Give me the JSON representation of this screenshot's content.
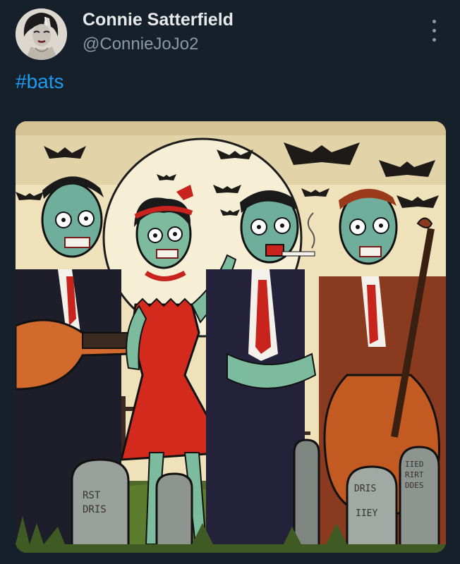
{
  "post": {
    "author": {
      "display_name": "Connie Satterfield",
      "handle": "@ConnieJoJo2",
      "avatar": "bride-of-frankenstein-avatar"
    },
    "text": "#bats",
    "more_icon": "more-vertical-icon",
    "media": {
      "description": "illustrated zombie rockabilly band in a graveyard with bats",
      "gravestone_text": [
        "RST",
        "DRIS",
        "DRIS",
        "IIEY",
        "IIED",
        "RIRT",
        "DDES"
      ]
    }
  },
  "colors": {
    "background": "#15202b",
    "primary_text": "#e7e9ea",
    "secondary_text": "#8b98a5",
    "link": "#1d9bf0"
  }
}
